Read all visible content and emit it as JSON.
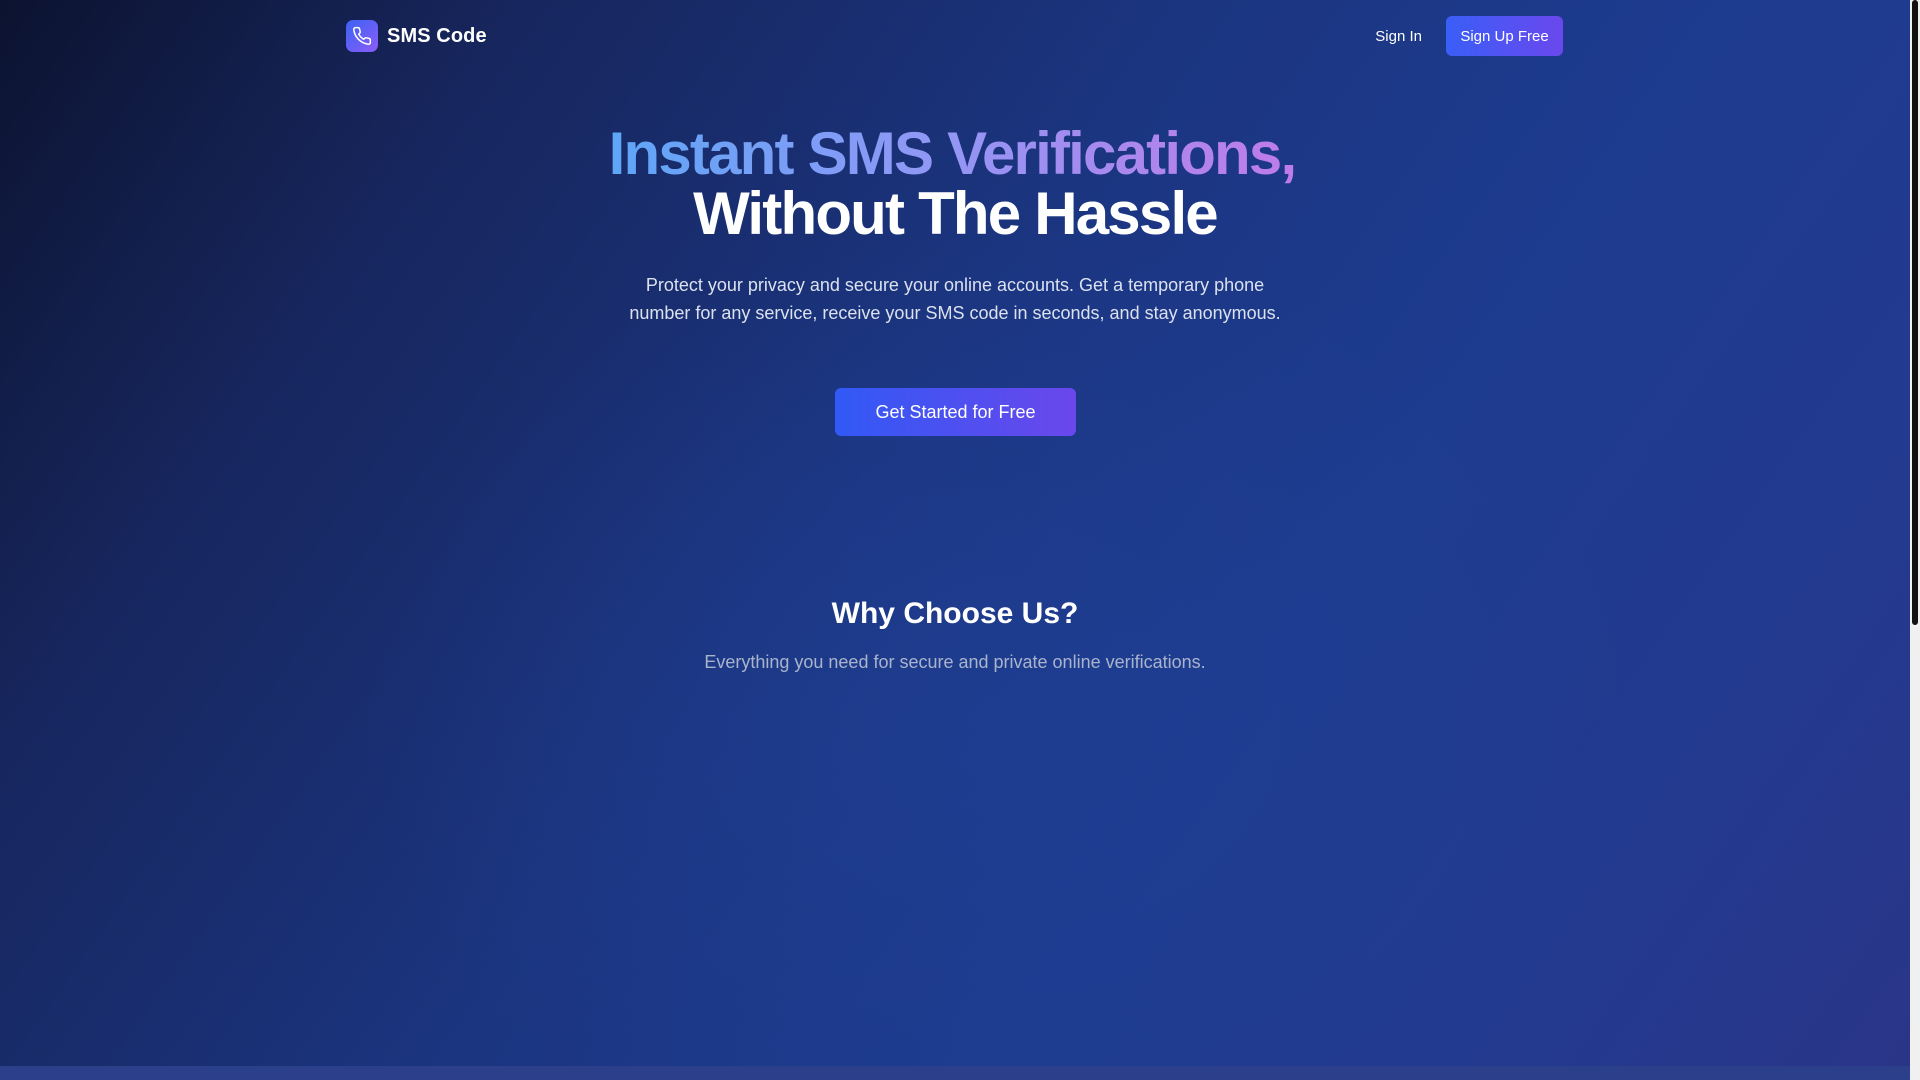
{
  "header": {
    "brand_name": "SMS Code",
    "signin_label": "Sign In",
    "signup_label": "Sign Up Free"
  },
  "hero": {
    "title_line1": "Instant SMS Verifications,",
    "title_line2": "Without The Hassle",
    "subtitle": "Protect your privacy and secure your online accounts. Get a temporary phone number for any service, receive your SMS code in seconds, and stay anonymous.",
    "cta_label": "Get Started for Free"
  },
  "why": {
    "title": "Why Choose Us?",
    "subtitle": "Everything you need for secure and private online verifications."
  },
  "icons": {
    "brand": "phone-icon"
  },
  "colors": {
    "accent_blue": "#3a5ef6",
    "accent_purple": "#6a48ee",
    "title_gradient_start": "#5ea6f7",
    "title_gradient_end": "#c07be8"
  }
}
